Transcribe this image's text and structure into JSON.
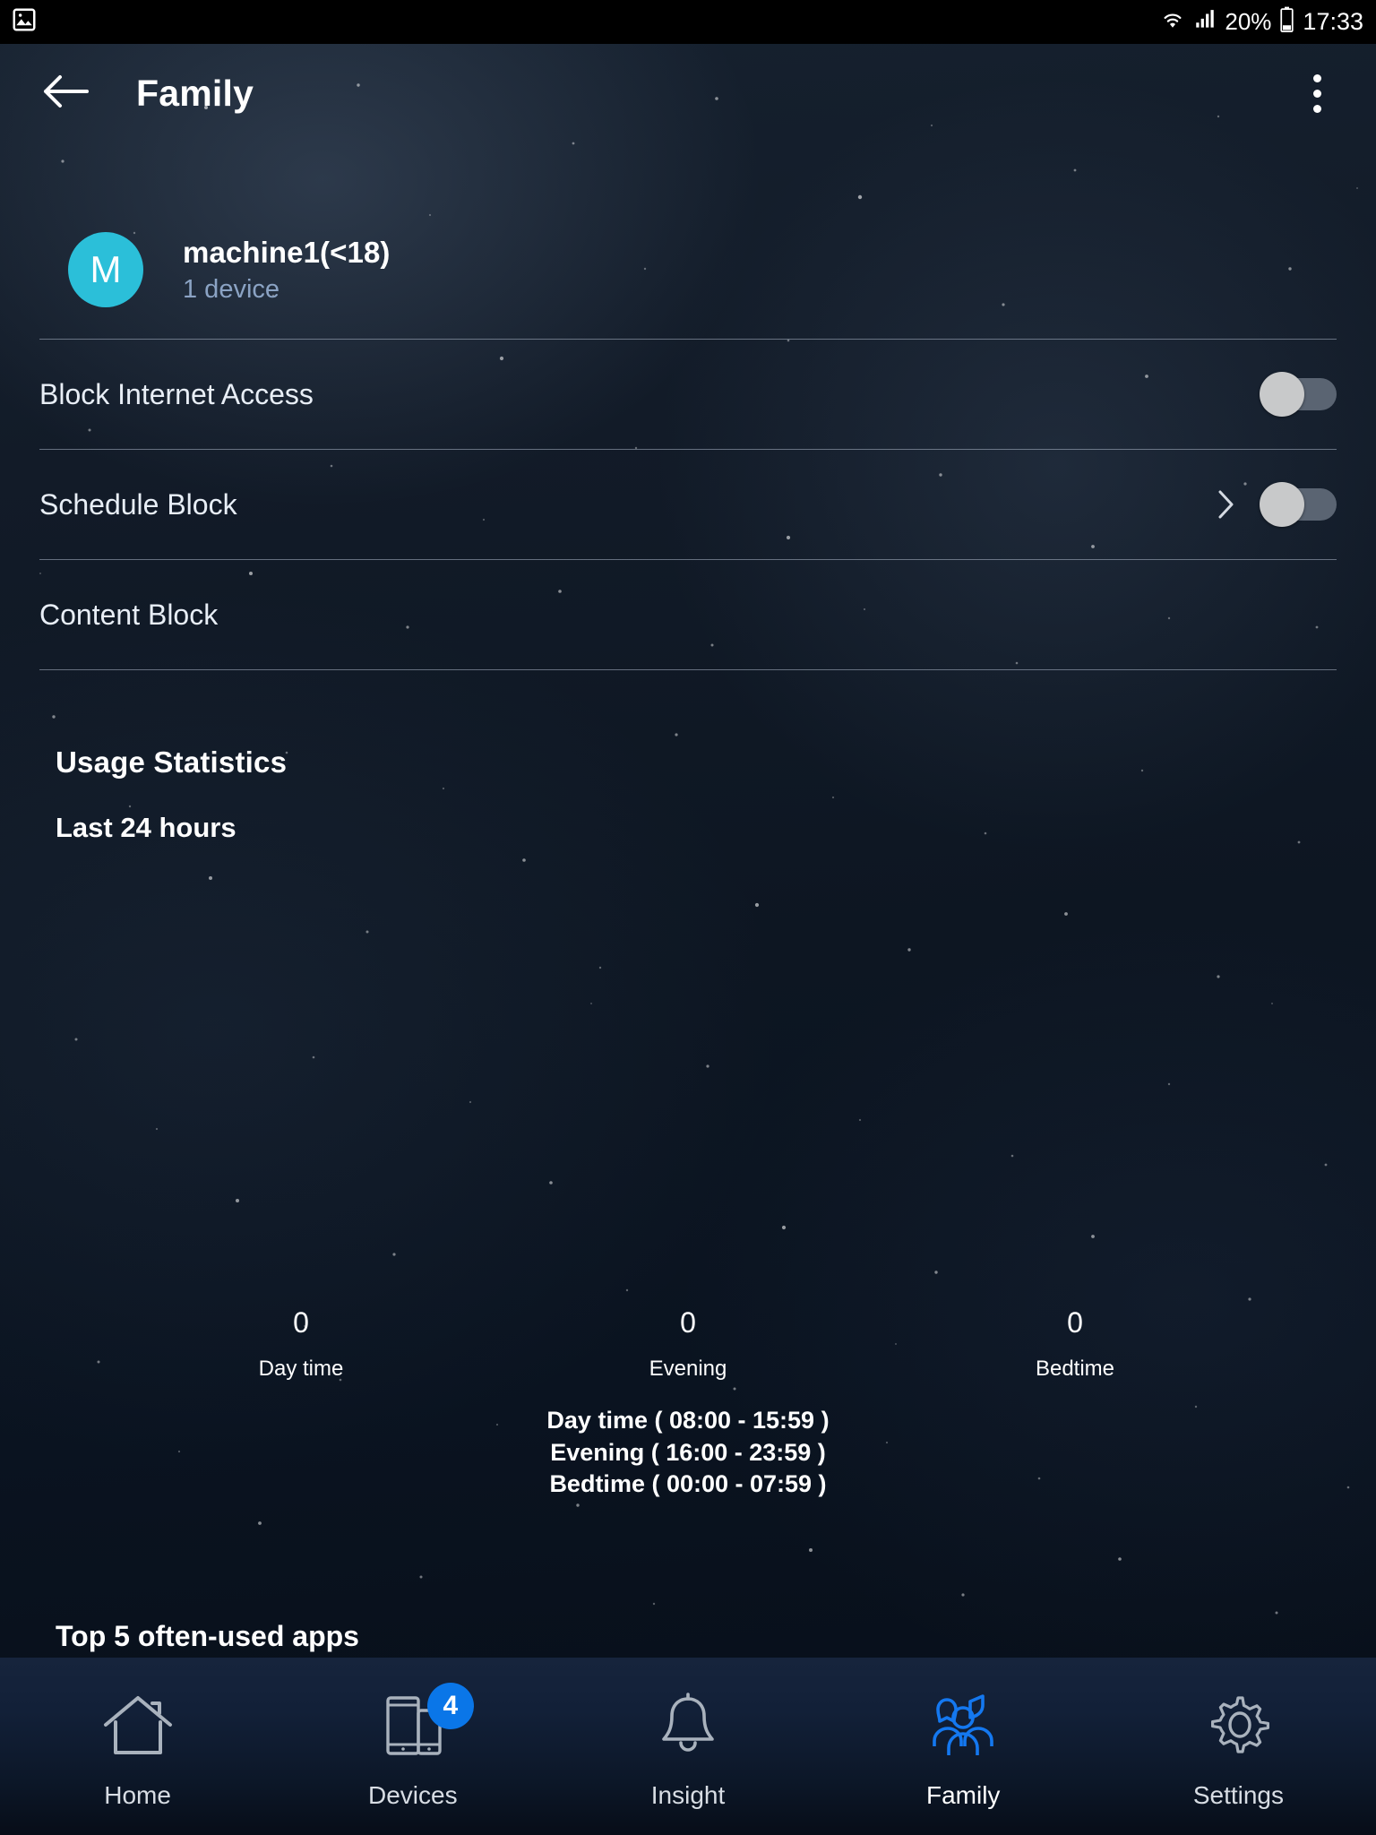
{
  "status_bar": {
    "wifi_icon": "wifi-icon",
    "signal_icon": "cellular-signal-icon",
    "battery_percent": "20%",
    "battery_icon": "battery-icon",
    "time": "17:33",
    "notification_icon": "image-notification-icon"
  },
  "app_bar": {
    "back_icon": "back-arrow-icon",
    "title": "Family",
    "overflow_icon": "overflow-menu-icon"
  },
  "profile": {
    "avatar_initial": "M",
    "avatar_color": "#2bbfd9",
    "name": "machine1(<18)",
    "device_count": "1 device"
  },
  "settings_rows": [
    {
      "label": "Block Internet Access",
      "has_chevron": false,
      "has_toggle": true,
      "toggle_state": "off"
    },
    {
      "label": "Schedule Block",
      "has_chevron": true,
      "has_toggle": true,
      "toggle_state": "off"
    },
    {
      "label": "Content Block",
      "has_chevron": false,
      "has_toggle": false,
      "toggle_state": ""
    }
  ],
  "usage": {
    "title": "Usage Statistics",
    "subtitle": "Last 24 hours"
  },
  "chart_data": {
    "type": "bar",
    "title": "Usage Statistics",
    "subtitle": "Last 24 hours",
    "categories": [
      "Day time",
      "Evening",
      "Bedtime"
    ],
    "values": [
      0,
      0,
      0
    ],
    "value_labels": [
      "0",
      "0",
      "0"
    ],
    "xlabel": "",
    "ylabel": "",
    "ylim": [
      0,
      0
    ],
    "grid": false,
    "legend_position": "below",
    "annotations": [
      "Day time ( 08:00 - 15:59 )",
      "Evening ( 16:00 - 23:59 )",
      "Bedtime ( 00:00 - 07:59 )"
    ]
  },
  "top_apps": {
    "heading": "Top 5 often-used apps"
  },
  "bottom_nav": {
    "active_index": 3,
    "items": [
      {
        "label": "Home",
        "icon": "home-icon",
        "badge": ""
      },
      {
        "label": "Devices",
        "icon": "devices-icon",
        "badge": "4"
      },
      {
        "label": "Insight",
        "icon": "bell-icon",
        "badge": ""
      },
      {
        "label": "Family",
        "icon": "family-group-icon",
        "badge": ""
      },
      {
        "label": "Settings",
        "icon": "gear-icon",
        "badge": ""
      }
    ]
  },
  "colors": {
    "accent_blue": "#0a76e8",
    "family_active": "#1478f0",
    "avatar_cyan": "#2bbfd9",
    "sub_text_blue": "#8ba3c4"
  }
}
